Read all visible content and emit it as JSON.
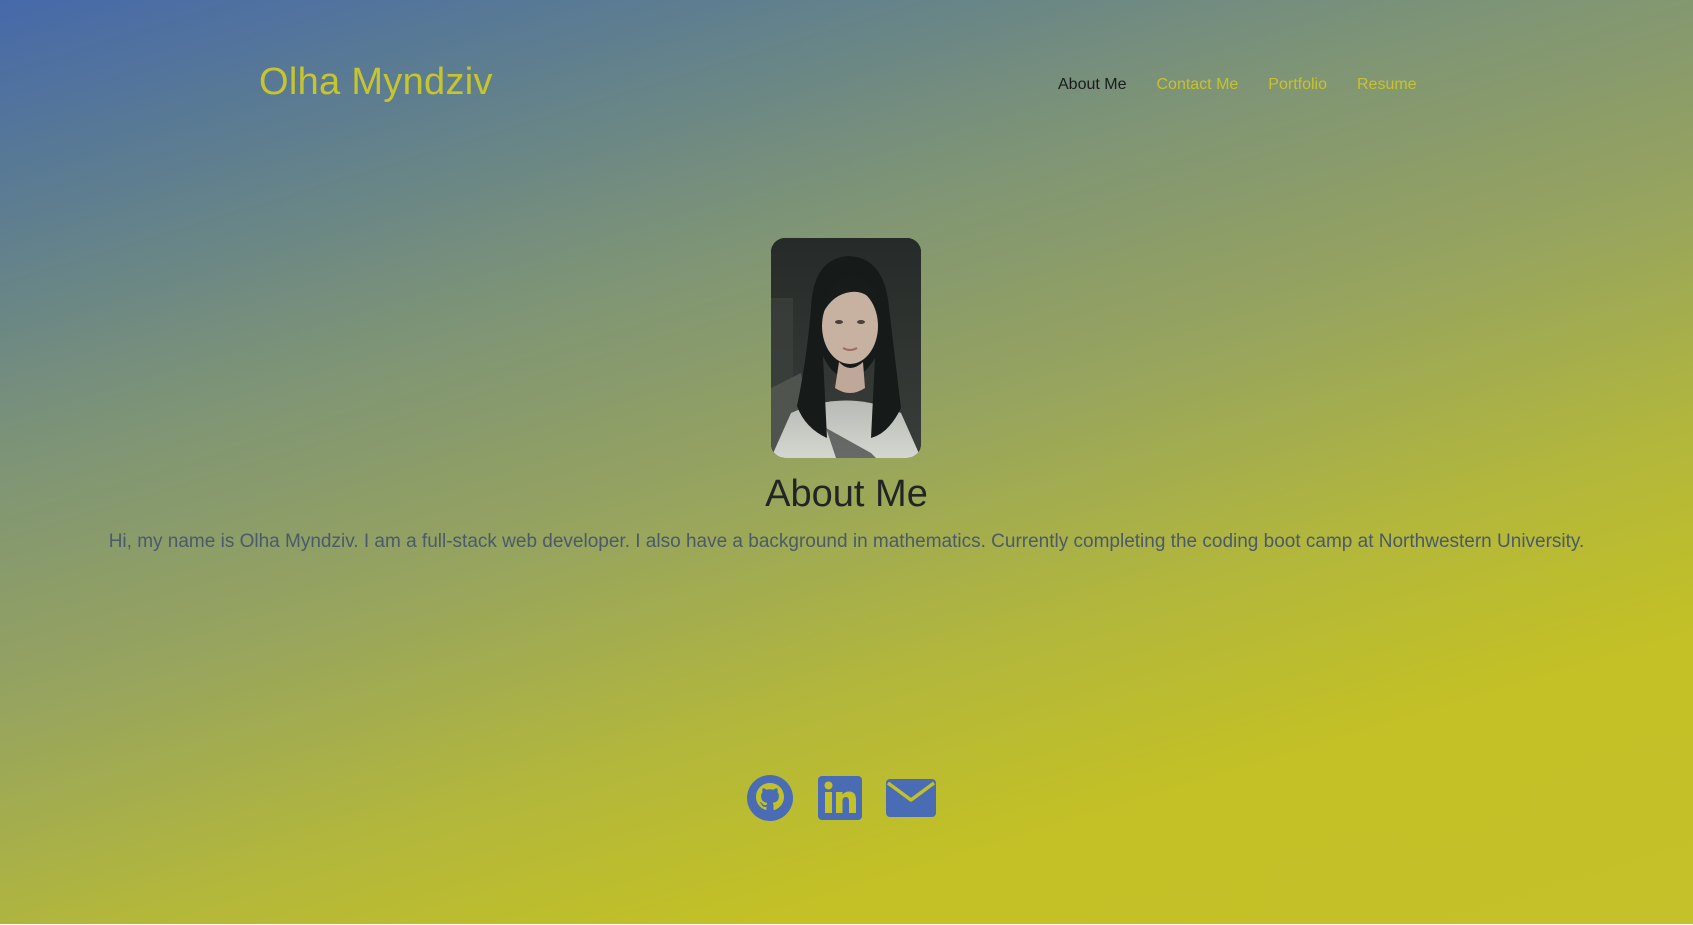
{
  "header": {
    "site_title": "Olha Myndziv",
    "nav": [
      {
        "label": "About Me",
        "active": true
      },
      {
        "label": "Contact Me",
        "active": false
      },
      {
        "label": "Portfolio",
        "active": false
      },
      {
        "label": "Resume",
        "active": false
      }
    ]
  },
  "about": {
    "heading": "About Me",
    "bio": "Hi, my name is Olha Myndziv. I am a full-stack web developer. I also have a background in mathematics. Currently completing the coding boot camp at Northwestern University."
  },
  "social": [
    {
      "icon": "github-icon"
    },
    {
      "icon": "linkedin-icon"
    },
    {
      "icon": "email-icon"
    }
  ],
  "colors": {
    "gradient_top": "#4669aa",
    "gradient_bottom": "#c4c12a",
    "accent_yellow": "#c7c52d",
    "icon_blue": "#4a6cb4",
    "active_nav": "#1b1b1b"
  }
}
